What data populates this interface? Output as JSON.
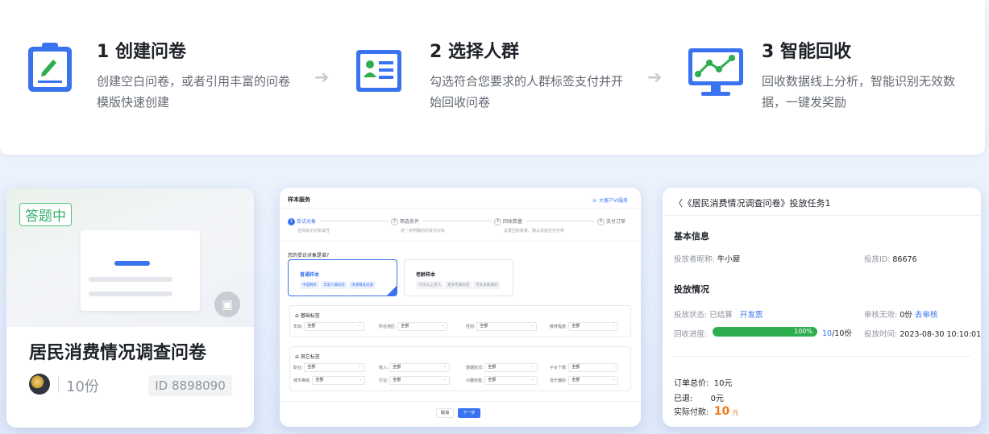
{
  "steps": [
    {
      "title": "1 创建问卷",
      "desc": "创建空白问卷，或者引用丰富的问卷模版快速创建",
      "icon": "clipboard-edit-icon"
    },
    {
      "title": "2 选择人群",
      "desc": "勾选符合您要求的人群标签支付并开始回收问卷",
      "icon": "user-list-icon"
    },
    {
      "title": "3 智能回收",
      "desc": "回收数据线上分析，智能识别无效数据，一键发奖励",
      "icon": "monitor-chart-icon"
    }
  ],
  "survey_card": {
    "badge": "答题中",
    "title": "居民消费情况调查问卷",
    "count": "10份",
    "id": "ID  8898090"
  },
  "sample_service": {
    "header": "样本服务",
    "service_link": "大客户VI服务",
    "steps": [
      {
        "num": "1",
        "label": "受访对象",
        "sub": "选择受访对象属性"
      },
      {
        "num": "2",
        "label": "筛选条件",
        "sub": "进一步明确您的受访对象"
      },
      {
        "num": "3",
        "label": "回收数量",
        "sub": "设置回收数量、确认投放任务名称"
      },
      {
        "num": "4",
        "label": "支付订单",
        "sub": ""
      }
    ],
    "question": "您的受访对象是谁?",
    "options": [
      {
        "title": "普通样本",
        "tags": [
          "中国网民",
          "丰富人群标签",
          "快速精准投送"
        ]
      },
      {
        "title": "老龄样本",
        "tags": [
          "55岁以上老人",
          "更多专属标签",
          "子女协助填答"
        ]
      }
    ],
    "basic_section": {
      "title": "⊖ 基础标签",
      "fields": [
        {
          "label": "年龄:",
          "value": "全部"
        },
        {
          "label": "所在地区:",
          "value": "全部"
        },
        {
          "label": "性别:",
          "value": "全部"
        },
        {
          "label": "教育程度:",
          "value": "全部"
        }
      ]
    },
    "other_section": {
      "title": "⊖ 其它标签",
      "fields": [
        {
          "label": "职业:",
          "value": "全部"
        },
        {
          "label": "收入:",
          "value": "全部"
        },
        {
          "label": "婚姻状况:",
          "value": "全部"
        },
        {
          "label": "子女个数:",
          "value": "全部"
        },
        {
          "label": "城市等级:",
          "value": "全部"
        },
        {
          "label": "行业:",
          "value": "全部"
        },
        {
          "label": "兴趣标签:",
          "value": "全部"
        },
        {
          "label": "音乐偏好:",
          "value": "全部"
        }
      ]
    },
    "cancel": "取消",
    "next": "下一步"
  },
  "task_card": {
    "header": "《居民消费情况调查问卷》投放任务1",
    "basic_title": "基本信息",
    "nickname_label": "投放者昵称:",
    "nickname": "牛小犀",
    "task_id_label": "投放ID:",
    "task_id": "86676",
    "status_title": "投放情况",
    "status_label": "投放状态:",
    "status": "已结算",
    "invoice": "开发票",
    "invalid_label": "审核无效:",
    "invalid": "0份",
    "review": "去审核",
    "progress_label": "回收进度:",
    "progress_pct": "100%",
    "progress_value": 1.0,
    "progress_done": "10",
    "progress_total": "/10份",
    "time_label": "投放时间:",
    "time": "2023-08-30 10:10:01",
    "order_total_label": "订单总价:",
    "order_total": "10元",
    "refund_label": "已退:",
    "refund": "0元",
    "paid_label": "实际付款:",
    "paid": "10",
    "paid_unit": "元"
  }
}
